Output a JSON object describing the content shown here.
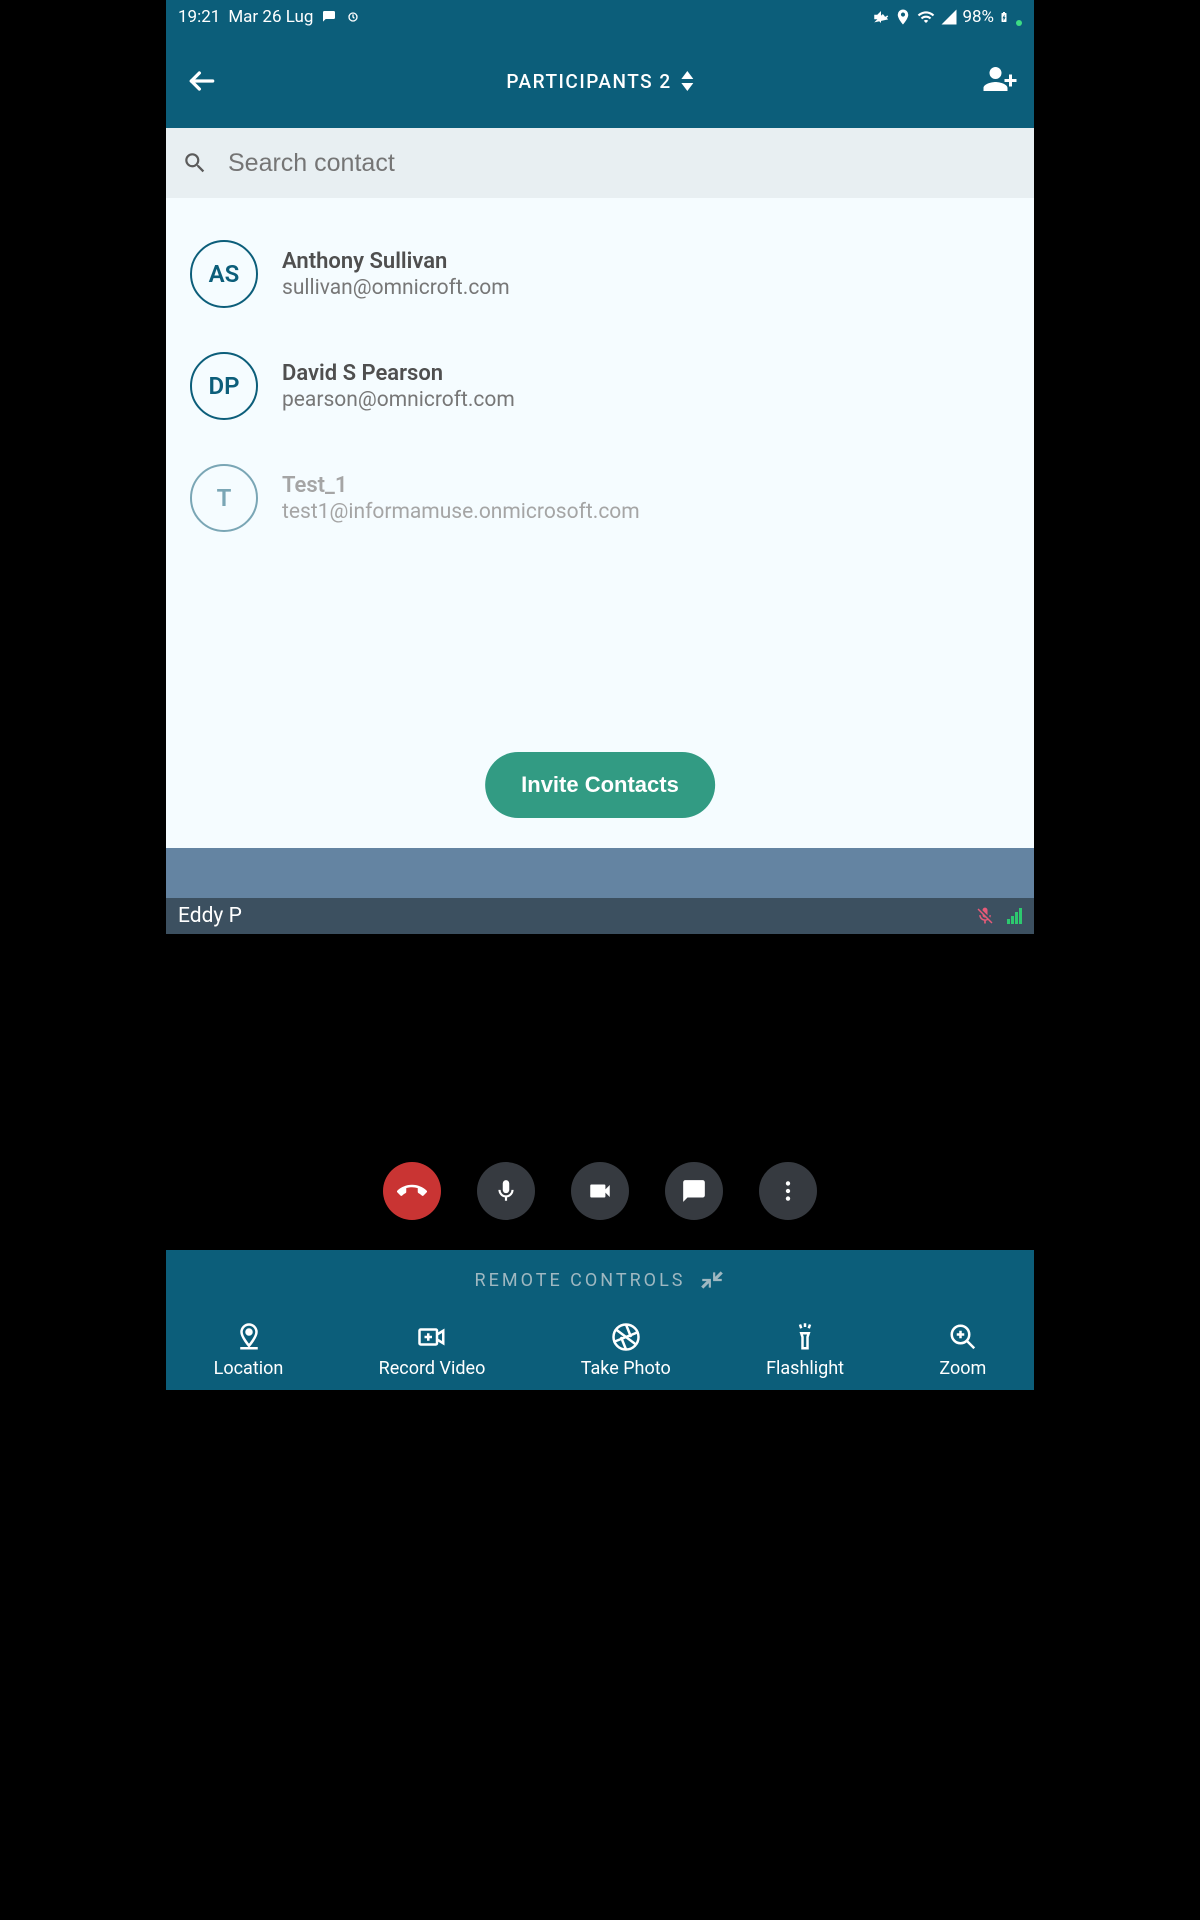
{
  "status": {
    "time": "19:21",
    "date": "Mar 26 Lug",
    "battery": "98%"
  },
  "header": {
    "title": "PARTICIPANTS 2"
  },
  "search": {
    "placeholder": "Search contact"
  },
  "contacts": [
    {
      "initials": "AS",
      "name": "Anthony Sullivan",
      "email": "sullivan@omnicroft.com",
      "faded": false
    },
    {
      "initials": "DP",
      "name": "David S Pearson",
      "email": "pearson@omnicroft.com",
      "faded": false
    },
    {
      "initials": "T",
      "name": "Test_1",
      "email": "test1@informamuse.onmicrosoft.com",
      "faded": true
    }
  ],
  "invite_label": "Invite Contacts",
  "participant_name": "Eddy P",
  "remote_label": "REMOTE CONTROLS",
  "bottom": {
    "location": "Location",
    "record": "Record Video",
    "photo": "Take Photo",
    "flashlight": "Flashlight",
    "zoom": "Zoom"
  }
}
